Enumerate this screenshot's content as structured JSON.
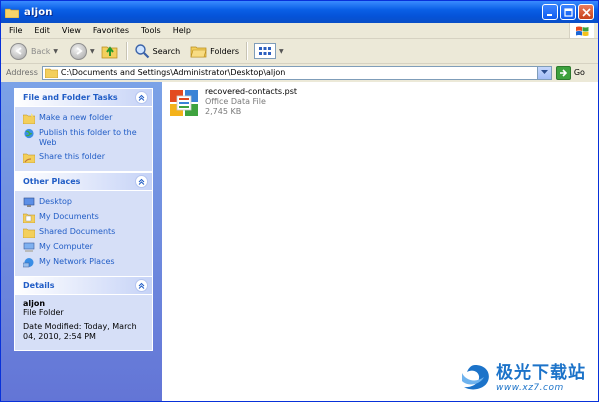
{
  "window": {
    "title": "aljon"
  },
  "menu": [
    "File",
    "Edit",
    "View",
    "Favorites",
    "Tools",
    "Help"
  ],
  "toolbar": {
    "back": "Back",
    "search": "Search",
    "folders": "Folders"
  },
  "address": {
    "label": "Address",
    "path": "C:\\Documents and Settings\\Administrator\\Desktop\\aljon",
    "go": "Go"
  },
  "panels": {
    "tasks": {
      "title": "File and Folder Tasks",
      "items": [
        "Make a new folder",
        "Publish this folder to the Web",
        "Share this folder"
      ]
    },
    "places": {
      "title": "Other Places",
      "items": [
        "Desktop",
        "My Documents",
        "Shared Documents",
        "My Computer",
        "My Network Places"
      ]
    },
    "details": {
      "title": "Details",
      "name": "aljon",
      "type": "File Folder",
      "modified": "Date Modified: Today, March 04, 2010, 2:54 PM"
    }
  },
  "file": {
    "name": "recovered-contacts.pst",
    "type": "Office Data File",
    "size": "2,745 KB"
  },
  "watermark": {
    "cn": "极光下载站",
    "url": "www.xz7.com"
  },
  "colors": {
    "titlebar": "#0553d8",
    "link": "#215dc6",
    "leftpane": "#7ba2e7"
  }
}
